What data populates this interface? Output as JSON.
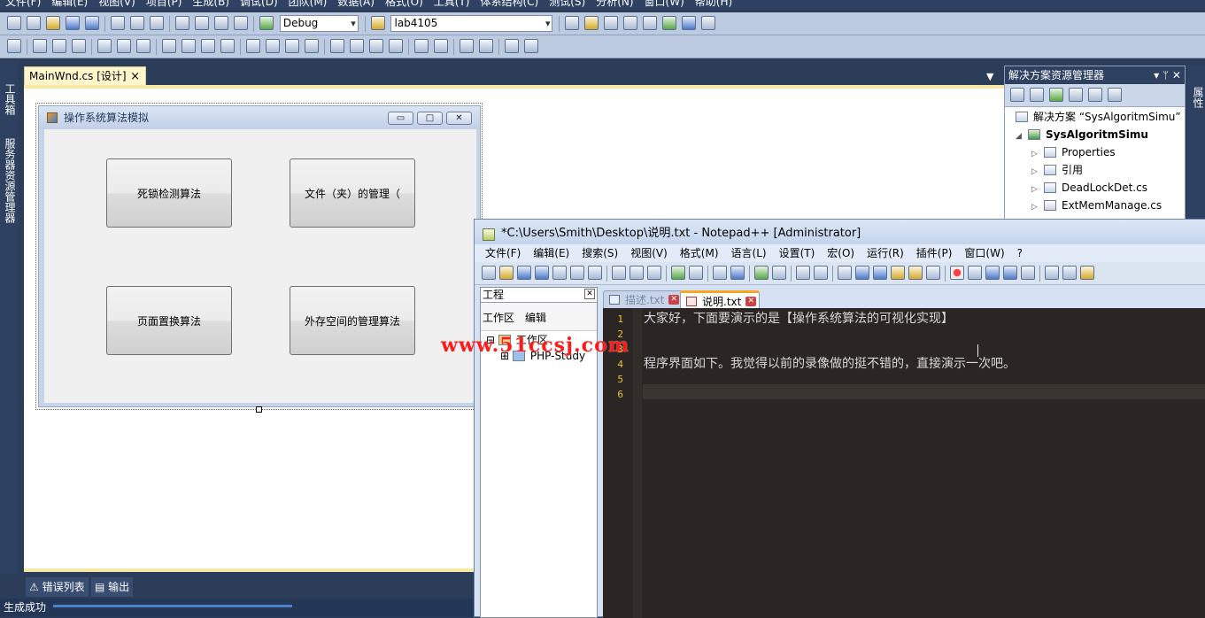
{
  "vs": {
    "menu": [
      "文件(F)",
      "编辑(E)",
      "视图(V)",
      "项目(P)",
      "生成(B)",
      "调试(D)",
      "团队(M)",
      "数据(A)",
      "格式(O)",
      "工具(T)",
      "体系结构(C)",
      "测试(S)",
      "分析(N)",
      "窗口(W)",
      "帮助(H)"
    ],
    "config_select": "Debug",
    "project_select": "lab4105",
    "left_strip": {
      "toolbox": "工具箱",
      "server_explorer": "服务器资源管理器"
    },
    "doc_tab": {
      "label": "MainWnd.cs [设计]",
      "close": "×"
    },
    "bottom_tabs": {
      "error_list": "错误列表",
      "output": "输出"
    },
    "status": "生成成功"
  },
  "winform": {
    "title": "操作系统算法模拟",
    "btn_min": "▭",
    "btn_max": "□",
    "btn_close": "✕",
    "buttons": [
      "死锁检测算法",
      "文件（夹）的管理（",
      "页面置换算法",
      "外存空间的管理算法"
    ]
  },
  "solution_explorer": {
    "title": "解决方案资源管理器",
    "pin": "▾ ᛘ ✕",
    "solution": "解决方案 “SysAlgoritmSimu”",
    "project": "SysAlgoritmSimu",
    "items": [
      "Properties",
      "引用",
      "DeadLockDet.cs",
      "ExtMemManage.cs"
    ],
    "right_strip": "属性"
  },
  "notepad": {
    "title": "*C:\\Users\\Smith\\Desktop\\说明.txt - Notepad++ [Administrator]",
    "menu": [
      "文件(F)",
      "编辑(E)",
      "搜索(S)",
      "视图(V)",
      "格式(M)",
      "语言(L)",
      "设置(T)",
      "宏(O)",
      "运行(R)",
      "插件(P)",
      "窗口(W)",
      "?"
    ],
    "project_panel": {
      "title": "工程",
      "close": "✕",
      "menu": [
        "工作区",
        "编辑"
      ],
      "tree_root": "工作区",
      "tree_child": "PHP-Study"
    },
    "tabs": [
      {
        "label": "描述.txt",
        "active": false
      },
      {
        "label": "说明.txt",
        "active": true
      }
    ],
    "lines": [
      {
        "no": "1",
        "text": "大家好，下面要演示的是【操作系统算法的可视化实现】"
      },
      {
        "no": "2",
        "text": ""
      },
      {
        "no": "3",
        "text": ""
      },
      {
        "no": "4",
        "text": "程序界面如下。我觉得以前的录像做的挺不错的，直接演示一次吧。"
      },
      {
        "no": "5",
        "text": ""
      },
      {
        "no": "6",
        "text": ""
      }
    ],
    "editor_bg": "#2b2623",
    "line_number_color": "#f1c232"
  },
  "watermark": "www.51ccsj.com"
}
